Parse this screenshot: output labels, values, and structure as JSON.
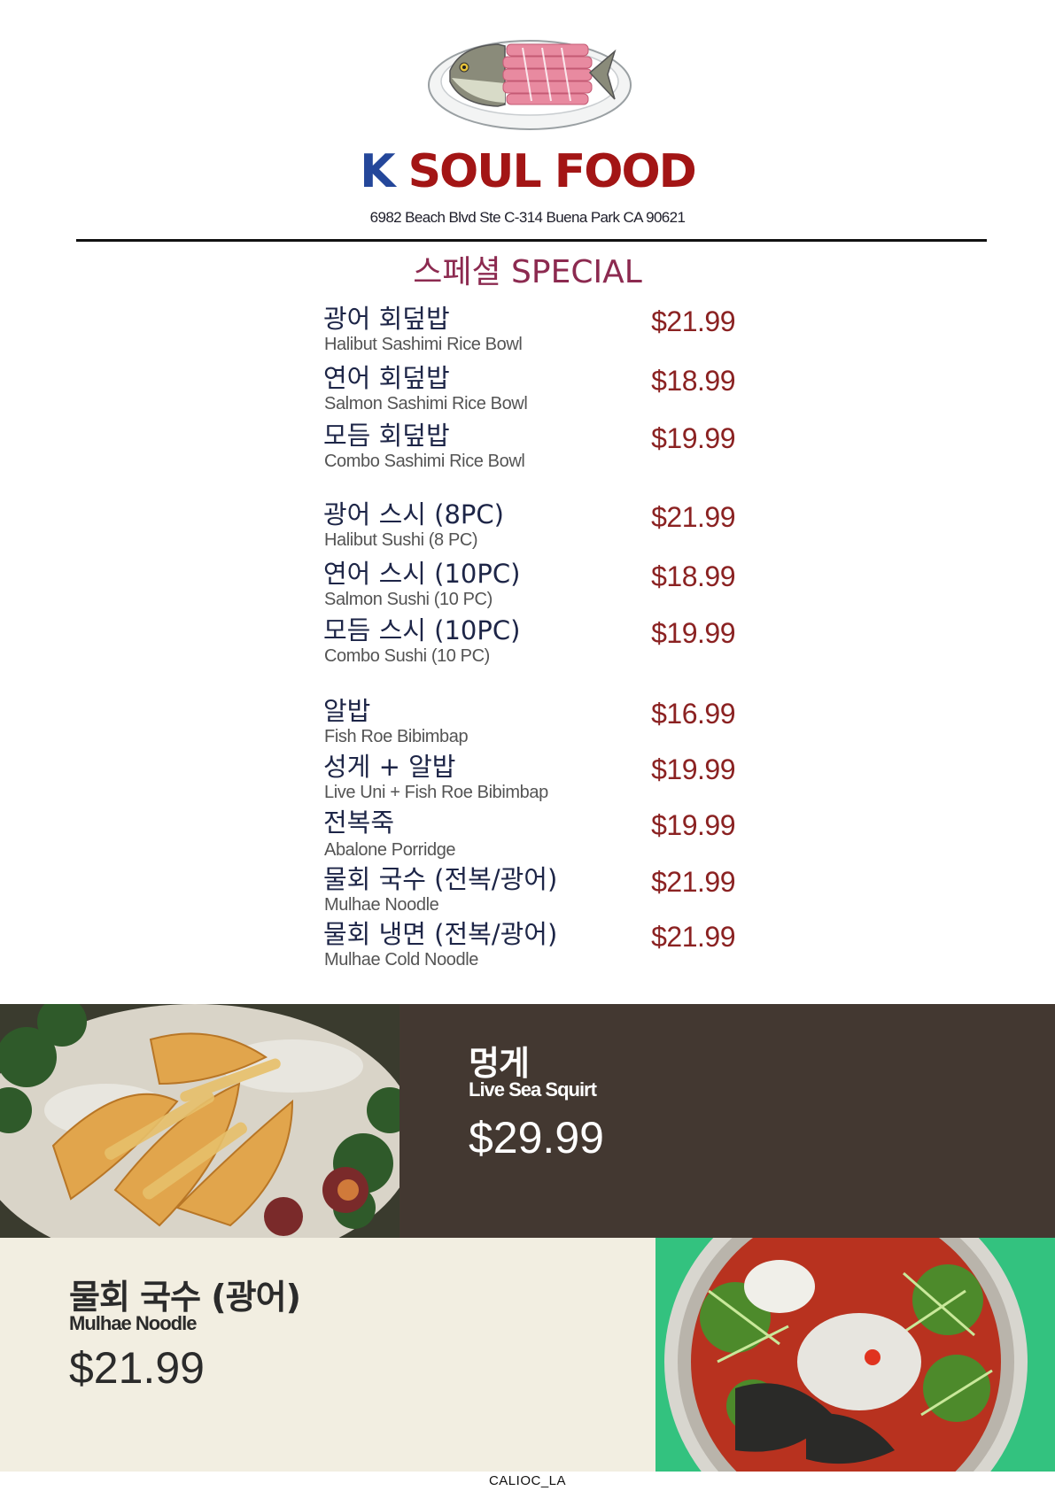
{
  "header": {
    "brand_k": "K",
    "brand_rest": "SOUL FOOD",
    "address": "6982 Beach Blvd Ste C-314 Buena Park CA 90621"
  },
  "section_title": "스페셜 SPECIAL",
  "menu": [
    {
      "ko": "광어 회덮밥",
      "en": "Halibut Sashimi Rice Bowl",
      "price": "$21.99"
    },
    {
      "ko": "연어 회덮밥",
      "en": "Salmon Sashimi Rice Bowl",
      "price": "$18.99"
    },
    {
      "ko": "모듬 회덮밥",
      "en": "Combo Sashimi Rice Bowl",
      "price": "$19.99"
    },
    {
      "ko": "광어 스시 (8PC)",
      "en": "Halibut Sushi (8 PC)",
      "price": "$21.99"
    },
    {
      "ko": "연어 스시 (10PC)",
      "en": "Salmon Sushi (10 PC)",
      "price": "$18.99"
    },
    {
      "ko": "모듬 스시 (10PC)",
      "en": "Combo Sushi (10 PC)",
      "price": "$19.99"
    },
    {
      "ko": "알밥",
      "en": "Fish Roe Bibimbap",
      "price": "$16.99"
    },
    {
      "ko": "성게 + 알밥",
      "en": "Live Uni + Fish Roe Bibimbap",
      "price": "$19.99"
    },
    {
      "ko": "전복죽",
      "en": "Abalone Porridge",
      "price": "$19.99"
    },
    {
      "ko": "물회 국수 (전복/광어)",
      "en": "Mulhae Noodle",
      "price": "$21.99"
    },
    {
      "ko": "물회 냉면 (전복/광어)",
      "en": "Mulhae Cold Noodle",
      "price": "$21.99"
    }
  ],
  "features": [
    {
      "ko": "멍게",
      "en": "Live Sea Squirt",
      "price": "$29.99"
    },
    {
      "ko": "물회 국수 (광어)",
      "en": "Mulhae Noodle",
      "price": "$21.99"
    }
  ],
  "footer": "CALIOC_LA",
  "colors": {
    "brand_blue": "#24479a",
    "brand_red": "#a31515",
    "section_title": "#8c2a50",
    "price": "#8b2222",
    "dark_panel": "#433831",
    "cream_panel": "#f2eee1"
  },
  "images": {
    "logo": "fish-plate-illustration",
    "photo1": "sea-squirt-dish-photo",
    "photo2": "mulhae-noodle-bowl-photo"
  }
}
